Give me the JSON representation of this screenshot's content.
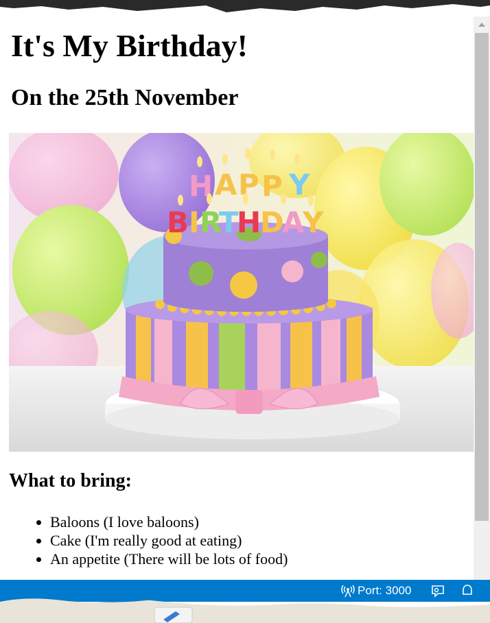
{
  "page": {
    "title": "It's My Birthday!",
    "subtitle": "On the 25th November",
    "cake_caption": "HAPPY BIRTHDAY",
    "bring_heading": "What to bring:",
    "bring_items": [
      "Baloons (I love baloons)",
      "Cake (I'm really good at eating)",
      "An appetite (There will be lots of food)"
    ]
  },
  "status_bar": {
    "port_label": "Port: 3000",
    "port_icon": "broadcast-icon",
    "feedback_icon": "feedback-icon",
    "bell_icon": "bell-icon"
  },
  "colors": {
    "status_bar": "#007acc",
    "scroll_thumb": "#c1c1c1"
  }
}
